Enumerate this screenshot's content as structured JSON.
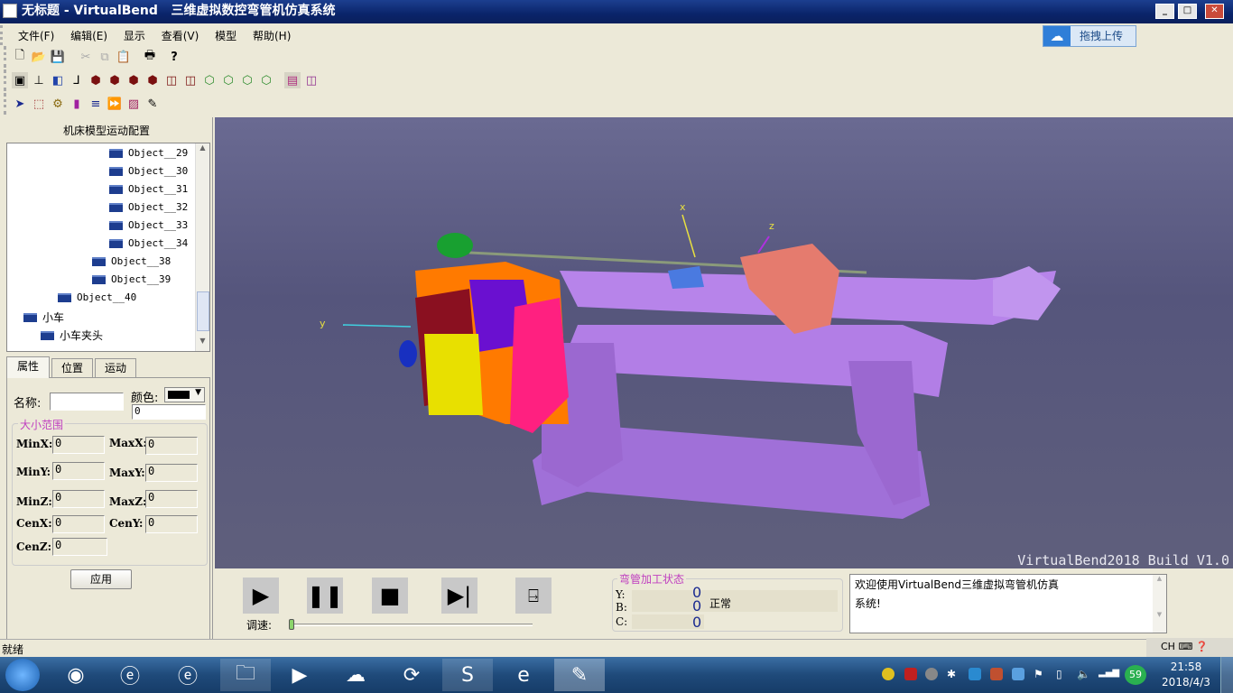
{
  "window": {
    "title": "无标题 - VirtualBend   三维虚拟数控弯管机仿真系统",
    "min": "_",
    "max": "□",
    "close": "✕"
  },
  "menu": [
    "文件(F)",
    "编辑(E)",
    "显示",
    "查看(V)",
    "模型",
    "帮助(H)"
  ],
  "upload_label": "拖拽上传",
  "left_panel": {
    "title": "机床模型运动配置",
    "tree": [
      "Object__29",
      "Object__30",
      "Object__31",
      "Object__32",
      "Object__33",
      "Object__34",
      "Object__38",
      "Object__39",
      "Object__40",
      "小车",
      "小车夹头"
    ],
    "tabs": [
      "属性",
      "位置",
      "运动"
    ],
    "name_label": "名称:",
    "name_value": "",
    "color_label": "颜色:",
    "color_value": "#000000",
    "color_num": "0",
    "group_title": "大小范围",
    "fields": {
      "MinX": "0",
      "MaxX": "0",
      "MinY": "0",
      "MaxY": "0",
      "MinZ": "0",
      "MaxZ": "0",
      "CenX": "0",
      "CenY": "0",
      "CenZ": "0"
    },
    "labels": {
      "MinX": "MinX:",
      "MaxX": "MaxX:",
      "MinY": "MinY:",
      "MaxY": "MaxY:",
      "MinZ": "MinZ:",
      "MaxZ": "MaxZ:",
      "CenX": "CenX:",
      "CenY": "CenY:",
      "CenZ": "CenZ:"
    },
    "apply": "应用"
  },
  "viewport": {
    "watermark": "VirtualBend2018 Build V1.0",
    "axis_x": "x",
    "axis_y": "y",
    "axis_z": "z"
  },
  "controls": {
    "speed_label": "调速:",
    "speed_value": 0
  },
  "state": {
    "title": "弯管加工状态",
    "Y_label": "Y:",
    "B_label": "B:",
    "C_label": "C:",
    "Y": "0",
    "B": "0",
    "C": "0",
    "status": "正常"
  },
  "log": {
    "lines": [
      "欢迎使用VirtualBend三维虚拟弯管机仿真",
      "系统!"
    ]
  },
  "status_bar": "就绪",
  "taskbar": {
    "ime": "CH",
    "time": "21:58",
    "date": "2018/4/3",
    "badge": "59"
  }
}
